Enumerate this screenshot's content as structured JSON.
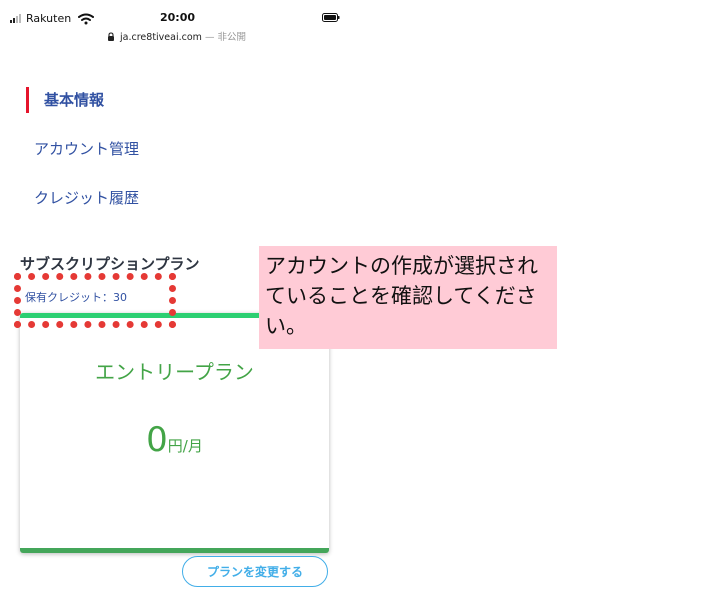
{
  "status_bar": {
    "carrier": "Rakuten",
    "time": "20:00",
    "signal_icon": "signal-icon",
    "wifi_icon": "wifi-icon",
    "battery_icon": "battery-icon"
  },
  "address_bar": {
    "domain": "ja.cre8tiveai.com",
    "suffix": "— 非公開",
    "lock_icon": "lock-icon"
  },
  "menu": {
    "items": [
      {
        "label": "基本情報",
        "active": true
      },
      {
        "label": "アカウント管理",
        "active": false
      },
      {
        "label": "クレジット履歴",
        "active": false
      }
    ]
  },
  "subscription": {
    "title": "サブスクリプションプラン",
    "credit_label": "保有クレジット：30",
    "plan_name": "エントリープラン",
    "price_value": "0",
    "price_unit": "円/月",
    "change_button_label": "プランを変更する"
  },
  "annotation": {
    "callout_text": "アカウントの作成が選択されていることを確認してください。",
    "highlight_color": "#e53935",
    "callout_background": "#ffcbd6"
  },
  "colors": {
    "menu_blue": "#3151a2",
    "active_red": "#e5142b",
    "plan_green": "#43a447",
    "button_blue": "#42aee8"
  }
}
